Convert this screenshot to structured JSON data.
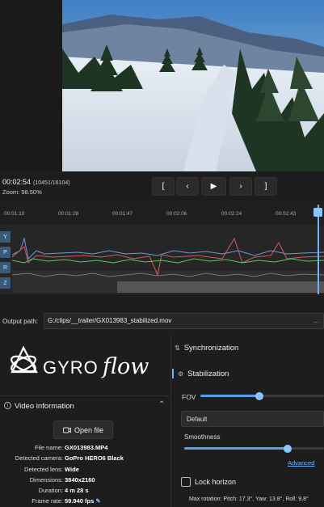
{
  "video": {
    "scene": "snowy-mountain-forest"
  },
  "transport": {
    "timecode": "00:02:54",
    "frames": "(10451/16104)",
    "zoom": "Zoom: 98.50%",
    "buttons": [
      "[",
      "‹",
      "▶",
      "›",
      "]"
    ]
  },
  "timeline": {
    "ticks": [
      "00:01:10",
      "00:01:28",
      "00:01:47",
      "00:02:06",
      "00:02:24",
      "00:02:43"
    ],
    "axes": [
      "Y",
      "P",
      "R",
      "Z"
    ]
  },
  "output": {
    "label": "Output path:",
    "value": "G:/clips/__trailer/GX013983_stabilized.mov",
    "more": "..."
  },
  "logo": {
    "text_left": "GYRO",
    "text_right": "flow"
  },
  "video_info": {
    "title": "Video information",
    "open_file": "Open file",
    "rows": [
      {
        "k": "File name:",
        "v": "GX013983.MP4"
      },
      {
        "k": "Detected camera:",
        "v": "GoPro HERO6 Black"
      },
      {
        "k": "Detected lens:",
        "v": "Wide"
      },
      {
        "k": "Dimensions:",
        "v": "3840x2160"
      },
      {
        "k": "Duration:",
        "v": "4 m 28 s"
      },
      {
        "k": "Frame rate:",
        "v": "59.940 fps"
      }
    ]
  },
  "right_panel": {
    "sync": "Synchronization",
    "stab": "Stabilization",
    "fov": "FOV",
    "fov_value": 0.42,
    "method": "Default",
    "smoothness": "Smoothness",
    "smoothness_value": 0.72,
    "advanced": "Advanced",
    "lock_horizon": "Lock horizon",
    "max_rotation": "Max rotation: Pitch: 17.3°, Yaw: 13.8°, Roll: 9.8°"
  },
  "colors": {
    "accent": "#6db3ff",
    "bg": "#1d1d1d"
  }
}
